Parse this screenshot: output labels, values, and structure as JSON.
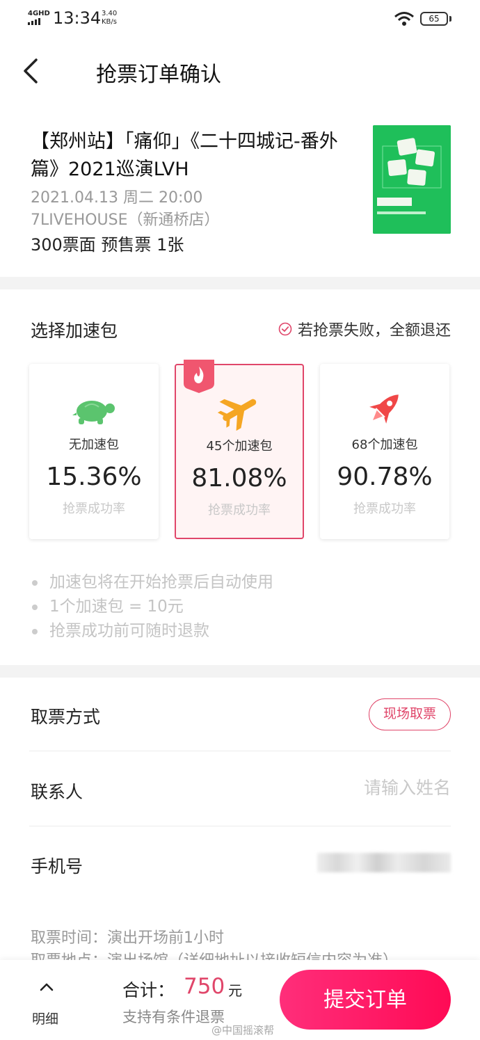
{
  "status_bar": {
    "network": "4GHD",
    "time": "13:34",
    "speed_value": "3.40",
    "speed_unit": "KB/s",
    "battery": "65"
  },
  "header": {
    "title": "抢票订单确认",
    "back_icon": "chevron-left-icon"
  },
  "event": {
    "title": "【郑州站】「痛仰」《二十四城记-番外篇》2021巡演LVH",
    "datetime": "2021.04.13 周二 20:00",
    "venue": "7LIVEHOUSE（新通桥店）",
    "ticket_info": "300票面 预售票 1张"
  },
  "acceleration": {
    "section_title": "选择加速包",
    "refund_note": "若抢票失败，全额退还",
    "packages": [
      {
        "icon": "turtle-icon",
        "label": "无加速包",
        "rate": "15.36%",
        "sublabel": "抢票成功率",
        "selected": false
      },
      {
        "icon": "airplane-icon",
        "label": "45个加速包",
        "rate": "81.08%",
        "sublabel": "抢票成功率",
        "selected": true
      },
      {
        "icon": "rocket-icon",
        "label": "68个加速包",
        "rate": "90.78%",
        "sublabel": "抢票成功率",
        "selected": false
      }
    ],
    "notes": [
      "加速包将在开始抢票后自动使用",
      "1个加速包 = 10元",
      "抢票成功前可随时退款"
    ]
  },
  "form": {
    "pickup_label": "取票方式",
    "pickup_value": "现场取票",
    "contact_label": "联系人",
    "contact_placeholder": "请输入姓名",
    "phone_label": "手机号"
  },
  "pickup_info": {
    "time": "取票时间：演出开场前1小时",
    "location": "取票地点：演出场馆（详细地址以接收短信内容为准）"
  },
  "footer": {
    "detail_label": "明细",
    "total_label": "合计：",
    "total_amount": "750",
    "total_unit": "元",
    "refund_condition": "支持有条件退票",
    "submit_label": "提交订单"
  },
  "watermark": "@中国摇滚帮",
  "colors": {
    "accent": "#e0466a",
    "submit_start": "#ff2e7a",
    "submit_end": "#ff0a55",
    "turtle": "#5bc46e",
    "airplane": "#f5a623",
    "rocket": "#f04747",
    "poster": "#1db954"
  }
}
